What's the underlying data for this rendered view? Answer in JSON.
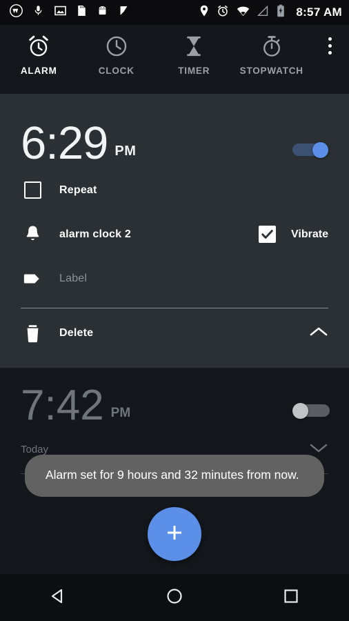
{
  "statusbar": {
    "time": "8:57 AM",
    "left_icons": [
      "app-logo-icon",
      "microphone-icon",
      "image-icon",
      "sd-card-icon",
      "android-robot-icon",
      "checkmark-flag-icon"
    ],
    "right_icons": [
      "location-pin-icon",
      "alarm-set-icon",
      "wifi-icon",
      "cell-signal-icon",
      "battery-charging-icon"
    ]
  },
  "tabs": [
    {
      "label": "ALARM",
      "icon": "alarm-clock-icon",
      "active": true
    },
    {
      "label": "CLOCK",
      "icon": "clock-icon",
      "active": false
    },
    {
      "label": "TIMER",
      "icon": "hourglass-icon",
      "active": false
    },
    {
      "label": "STOPWATCH",
      "icon": "stopwatch-icon",
      "active": false
    }
  ],
  "overflow_menu": "more-options-icon",
  "alarm_expanded": {
    "time": "6:29",
    "ampm": "PM",
    "enabled": true,
    "repeat": {
      "label": "Repeat",
      "checked": false
    },
    "ringtone": {
      "label": "alarm clock 2",
      "icon": "bell-icon"
    },
    "vibrate": {
      "label": "Vibrate",
      "checked": true
    },
    "alarm_label": {
      "placeholder": "Label",
      "value": "",
      "icon": "label-tag-icon"
    },
    "delete": {
      "label": "Delete",
      "icon": "trash-icon"
    },
    "collapse_icon": "chevron-up-icon"
  },
  "alarm_collapsed": {
    "time": "7:42",
    "ampm": "PM",
    "enabled": false,
    "subtitle": "Today",
    "expand_icon": "chevron-down-icon"
  },
  "fab": {
    "icon": "plus-icon",
    "label": "+"
  },
  "toast": {
    "message": "Alarm set for 9 hours and 32 minutes from now."
  },
  "navbar": [
    {
      "name": "back-button",
      "icon": "back-triangle-icon"
    },
    {
      "name": "home-button",
      "icon": "home-circle-icon"
    },
    {
      "name": "recents-button",
      "icon": "recents-square-icon"
    }
  ],
  "colors": {
    "accent": "#5b8fe8",
    "card_bg": "#2b3034",
    "page_bg": "#14181c",
    "statusbar_bg": "#0c0c0e"
  }
}
